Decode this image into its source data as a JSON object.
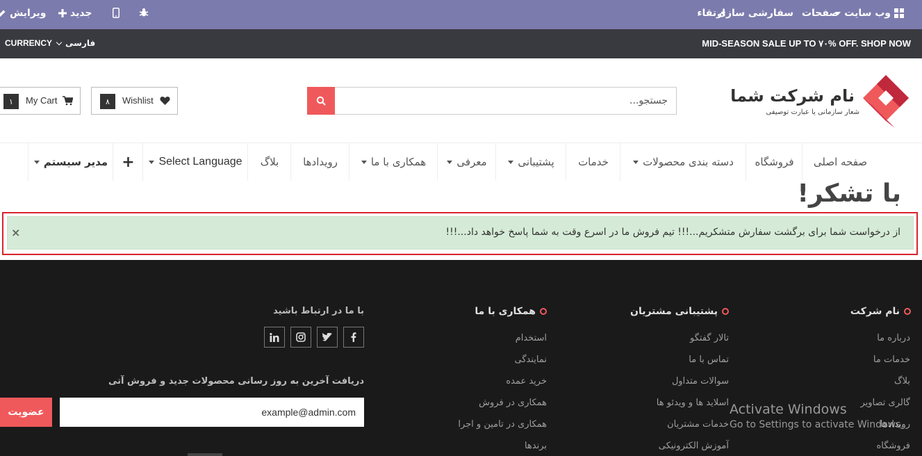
{
  "admin_bar": {
    "website_menu": "وب سایت",
    "pages": "صفحات",
    "customize": "سفارشی سازی",
    "upgrade": "ارتقاء",
    "new_label": "جدید",
    "edit_label": "ویرایش"
  },
  "announcement": {
    "sale_text": "MID-SEASON SALE UP TO ۷۰% OFF. SHOP NOW",
    "currency_label": "CURRENCY",
    "language_label": "فارسی"
  },
  "header": {
    "logo_name": "نام شرکت شما",
    "logo_tagline": "شعار سازمانی یا عبارت توصیفی",
    "search_placeholder": "جستجو...",
    "wishlist_label": "Wishlist",
    "wishlist_count": "۸",
    "cart_label": "My Cart",
    "cart_count": "۱"
  },
  "nav": {
    "items": [
      {
        "label": "صفحه اصلی"
      },
      {
        "label": "فروشگاه"
      },
      {
        "label": "دسته بندی محصولات"
      },
      {
        "label": "خدمات"
      },
      {
        "label": "پشتیبانی"
      },
      {
        "label": "معرفی"
      },
      {
        "label": "همکاری با ما"
      },
      {
        "label": "رویدادها"
      },
      {
        "label": "بلاگ"
      },
      {
        "label": "Select Language"
      },
      {
        "label": "+"
      },
      {
        "label": "مدیر سیستم"
      }
    ]
  },
  "main": {
    "title": "با تشکر!",
    "alert_text": "از درخواست شما برای برگشت سفارش متشکریم...!!! تیم فروش ما در اسرع وقت به شما پاسخ خواهد داد...!!!",
    "alert_close": "×"
  },
  "footer": {
    "col_company": {
      "title": "نام شرکت",
      "links": [
        "درباره ما",
        "خدمات ما",
        "بلاگ",
        "گالری تصاویر",
        "رویدادها",
        "فروشگاه"
      ]
    },
    "col_support": {
      "title": "پشتیبانی مشتریان",
      "links": [
        "تالار گفتگو",
        "تماس با ما",
        "سوالات متداول",
        "اسلاید ها و ویدئو ها",
        "خدمات مشتریان",
        "آموزش الکترونیکی"
      ]
    },
    "col_cooperation": {
      "title": "همکاری با ما",
      "links": [
        "استخدام",
        "نمایندگی",
        "خرید عمده",
        "همکاری در فروش",
        "همکاری در تامین و اجرا",
        "برندها"
      ]
    },
    "contact": {
      "title": "با ما در ارتباط باشید",
      "newsletter_text": "دریافت آخرین به روز رسانی محصولات جدید و فروش آتی",
      "email_value": "example@admin.com",
      "subscribe_label": "عضویت"
    }
  },
  "watermark": {
    "line1": "Activate Windows",
    "line2": "Go to Settings to activate Windows."
  },
  "colors": {
    "admin_bar": "#7c7bad",
    "announce_bar": "#393a3f",
    "accent": "#f0595b",
    "alert_bg": "#d5ebd7",
    "alert_border": "#d9242d",
    "footer_bg": "#1a1a1b"
  }
}
